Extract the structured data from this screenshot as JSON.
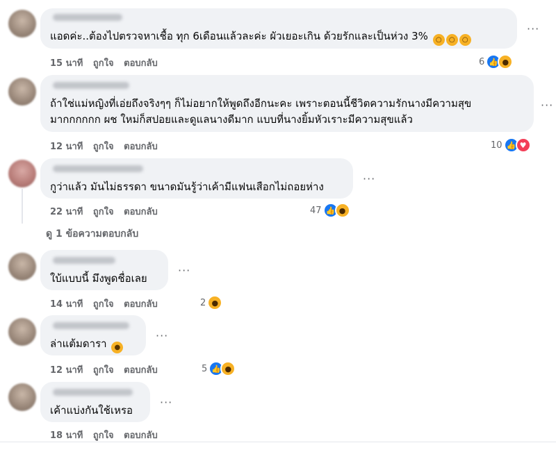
{
  "comments": [
    {
      "text_lines": [
        "แอดค่ะ..ต้องไปตรวจหาเชื้อ ทุก 6เดือนแล้วละค่ะ ผัวเยอะเกิน ด้วยรักและเป็นห่วง 3%"
      ],
      "time": "15 นาที",
      "like": "ถูกใจ",
      "reply": "ตอบกลับ",
      "reaction_count": "6",
      "reactions": [
        "like-icon",
        "haha-icon"
      ]
    },
    {
      "text_lines": [
        "ถ้าใช่แม่หญิงที่เอ่ยถึงจริงๆๆ ก็ไม่อยากให้พูดถึงอีกนะคะ เพราะตอนนี้ชีวิตความรักนางมีความสุข",
        "มากกกกกก ผช ใหม่ก็สปอยและดูแลนางดีมาก แบบที่นางยิ้มหัวเราะมีความสุขแล้ว"
      ],
      "time": "12 นาที",
      "like": "ถูกใจ",
      "reply": "ตอบกลับ",
      "reaction_count": "10",
      "reactions": [
        "like-icon",
        "love-icon"
      ]
    },
    {
      "text_lines": [
        "กูว่าแล้ว มันไม่ธรรดา ขนาดมันรู้ว่าเค้ามีแฟนเสือกไม่ถอยห่าง"
      ],
      "time": "22 นาที",
      "like": "ถูกใจ",
      "reply": "ตอบกลับ",
      "reaction_count": "47",
      "reactions": [
        "like-icon",
        "haha-icon"
      ],
      "view_replies": "ดู 1 ข้อความตอบกลับ"
    },
    {
      "text_lines": [
        "ใบ้แบบนี้ มึงพูดชื่อเลย"
      ],
      "time": "14 นาที",
      "like": "ถูกใจ",
      "reply": "ตอบกลับ",
      "reaction_count": "2",
      "reactions": [
        "haha-icon"
      ]
    },
    {
      "text_lines": [
        "ล่าแต้มดารา"
      ],
      "time": "12 นาที",
      "like": "ถูกใจ",
      "reply": "ตอบกลับ",
      "reaction_count": "5",
      "reactions": [
        "like-icon",
        "haha-icon"
      ]
    },
    {
      "text_lines": [
        "เค้าแบ่งกันใช้เหรอ"
      ],
      "time": "18 นาที",
      "like": "ถูกใจ",
      "reply": "ตอบกลับ",
      "reaction_count": "",
      "reactions": []
    }
  ],
  "more_label": "···",
  "colors": {
    "bubble": "#f0f2f5",
    "meta": "#65676b",
    "like": "#1877f2",
    "love": "#f33e58",
    "haha": "#f7b125"
  }
}
